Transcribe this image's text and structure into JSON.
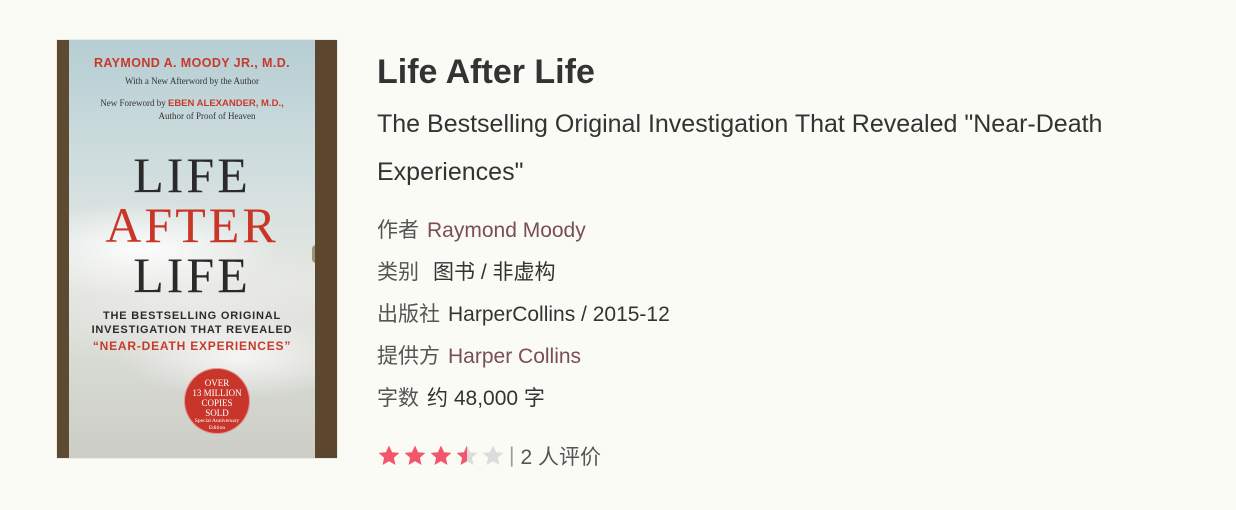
{
  "book": {
    "cover": {
      "author": "RAYMOND A. MOODY JR., M.D.",
      "afterword": "With a New Afterword by the Author",
      "foreword_prefix": "New Foreword by",
      "foreword_name": "EBEN ALEXANDER, M.D.,",
      "foreword_suffix": "Author of Proof of Heaven",
      "title_lines": [
        "LIFE",
        "AFTER",
        "LIFE"
      ],
      "tagline": [
        "THE BESTSELLING ORIGINAL",
        "INVESTIGATION THAT REVEALED",
        "“NEAR-DEATH EXPERIENCES”"
      ],
      "badge": [
        "OVER",
        "13 MILLION",
        "COPIES",
        "SOLD",
        "Special Anniversary",
        "Edition"
      ]
    },
    "title": "Life After Life",
    "subtitle": "The Bestselling Original Investigation That Revealed \"Near-Death Experiences\"",
    "meta": {
      "author_label": "作者",
      "author": "Raymond Moody",
      "category_label": "类别",
      "category": "图书 / 非虚构",
      "publisher_label": "出版社",
      "publisher": "HarperCollins / 2015-12",
      "provider_label": "提供方",
      "provider": "Harper Collins",
      "wordcount_label": "字数",
      "wordcount": "约 48,000 字"
    },
    "rating": {
      "stars": 3.5,
      "max": 5,
      "separator": "|",
      "count_text": "2 人评价"
    }
  },
  "colors": {
    "star_filled": "#f3566a",
    "star_empty": "#dcdcdc",
    "link": "#7a4e53",
    "background": "#fbfbf5"
  }
}
